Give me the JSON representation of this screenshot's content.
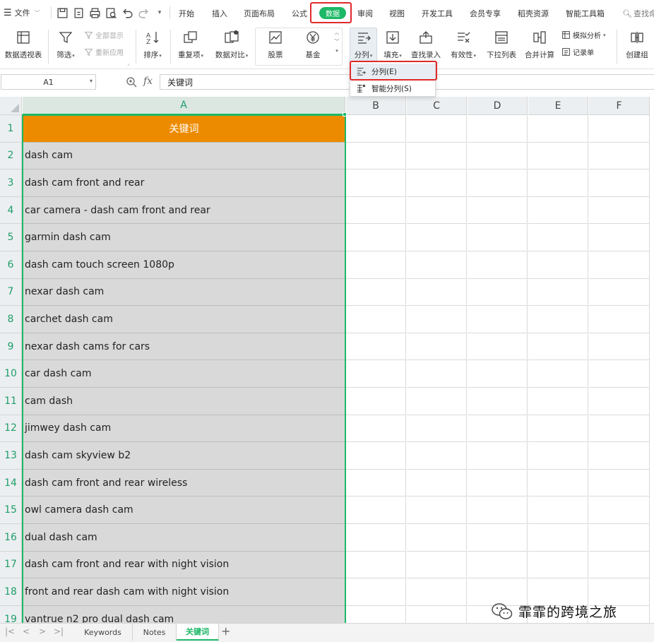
{
  "menu": {
    "file": "文件",
    "tabs": [
      "开始",
      "插入",
      "页面布局",
      "公式",
      "数据",
      "审阅",
      "视图",
      "开发工具",
      "会员专享",
      "稻壳资源",
      "智能工具箱"
    ],
    "active_tab": "数据",
    "search": "查找命"
  },
  "ribbon": {
    "pivot": "数据透视表",
    "filter": "筛选",
    "show_all": "全部显示",
    "reapply": "重新应用",
    "sort": "排序",
    "duplicates": "重复项",
    "compare": "数据对比",
    "stock": "股票",
    "fund": "基金",
    "split": "分列",
    "fill": "填充",
    "lookup_entry": "查找录入",
    "validity": "有效性",
    "dropdown_list": "下拉列表",
    "consolidate": "合并计算",
    "what_if": "模拟分析",
    "record_form": "记录单",
    "group": "创建组"
  },
  "dropdown": {
    "items": [
      "分列(E)",
      "智能分列(S)"
    ]
  },
  "formula_bar": {
    "name_box": "A1",
    "fx": "fx",
    "value": "关键词"
  },
  "grid": {
    "columns": [
      "A",
      "B",
      "C",
      "D",
      "E",
      "F"
    ],
    "rows": [
      "关键词",
      "dash cam",
      "dash cam front and rear",
      "car camera - dash cam front and rear",
      "garmin dash cam",
      "dash cam touch screen 1080p",
      "nexar dash cam",
      "carchet dash cam",
      "nexar dash cams for cars",
      "car dash cam",
      "cam dash",
      "jimwey dash cam",
      "dash cam skyview b2",
      "dash cam front and rear wireless",
      "owl camera dash cam",
      "dual dash cam",
      "dash cam front and rear with night vision",
      "front and rear dash cam with night vision",
      "vantrue n2 pro dual dash cam"
    ]
  },
  "sheets": {
    "tabs": [
      "Keywords",
      "Notes",
      "关键词"
    ],
    "active": "关键词"
  },
  "watermark": "霏霏的跨境之旅",
  "colors": {
    "accent_green": "#1db866",
    "header_orange": "#ed8b00",
    "highlight_red": "#e02a2a",
    "selected_fill": "#d9d9d9"
  }
}
